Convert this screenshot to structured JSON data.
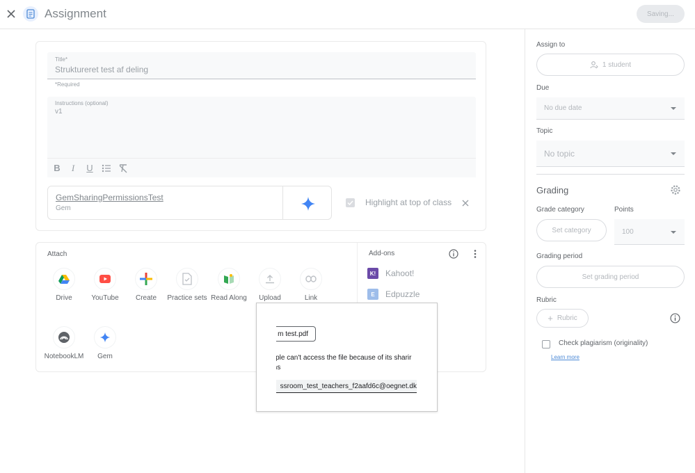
{
  "topbar": {
    "title": "Assignment",
    "saving_label": "Saving..."
  },
  "form": {
    "title_label": "Title*",
    "title_value": "Struktureret test af deling",
    "required_note": "*Required",
    "instructions_label": "Instructions (optional)",
    "instructions_value": "v1",
    "format_tools": [
      "bold",
      "italic",
      "underline",
      "bulleted-list",
      "clear-formatting"
    ]
  },
  "attachment": {
    "name": "GemSharingPermissionsTest",
    "type": "Gem",
    "highlight_label": "Highlight at top of class"
  },
  "attach": {
    "title": "Attach",
    "items": [
      {
        "label": "Drive",
        "icon": "drive-icon"
      },
      {
        "label": "YouTube",
        "icon": "youtube-icon"
      },
      {
        "label": "Create",
        "icon": "plus-icon"
      },
      {
        "label": "Practice sets",
        "icon": "practice-sets-icon"
      },
      {
        "label": "Read Along",
        "icon": "read-along-icon"
      },
      {
        "label": "Upload",
        "icon": "upload-icon"
      },
      {
        "label": "Link",
        "icon": "link-icon"
      },
      {
        "label": "NotebookLM",
        "icon": "notebooklm-icon"
      },
      {
        "label": "Gem",
        "icon": "gem-icon"
      }
    ]
  },
  "addons": {
    "title": "Add-ons",
    "items": [
      {
        "label": "Kahoot!",
        "logo": "K!",
        "color": "#46178f"
      },
      {
        "label": "Edpuzzle",
        "logo": "E",
        "color": "#5d8ee0"
      }
    ]
  },
  "popup": {
    "file_name": "m test.pdf",
    "warning": "eople can't access the file because of its sharir ions",
    "warning_line1": "eople can't access the file because of its sharir",
    "warning_line2": "ions",
    "email": "ssroom_test_teachers_f2aafd6c@oegnet.dk"
  },
  "sidebar": {
    "assign_to_label": "Assign to",
    "assign_to_value": "1 student",
    "due_label": "Due",
    "due_value": "No due date",
    "topic_label": "Topic",
    "topic_value": "No topic",
    "grading_title": "Grading",
    "grade_category_label": "Grade category",
    "grade_category_value": "Set category",
    "points_label": "Points",
    "points_value": "100",
    "grading_period_label": "Grading period",
    "grading_period_value": "Set grading period",
    "rubric_label": "Rubric",
    "rubric_button": "Rubric",
    "plagiarism_label": "Check plagiarism (originality)",
    "learn_more": "Learn more"
  },
  "colors": {
    "accent": "#4d8ad6",
    "gem_blue": "#4285f4",
    "youtube_red": "#ff4e45"
  }
}
